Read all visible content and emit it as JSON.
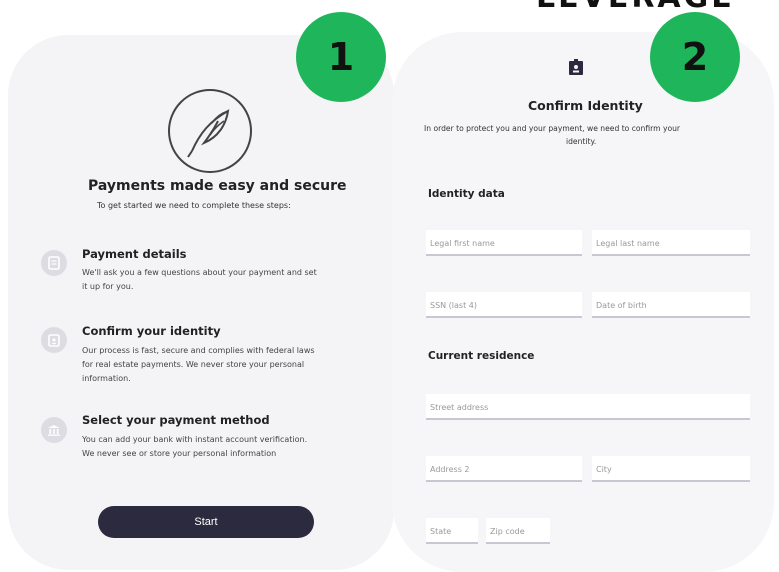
{
  "logo_text": "LEVERAGE",
  "badges": {
    "one": "1",
    "two": "2"
  },
  "intro": {
    "title": "Payments made easy and secure",
    "subtitle": "To get started we need to complete these steps:",
    "steps": [
      {
        "title": "Payment details",
        "line1": "We'll ask you a few questions about your payment and set",
        "line2": "it up for you."
      },
      {
        "title": "Confirm your identity",
        "line1": "Our process is fast, secure and complies with federal laws",
        "line2": "for real estate payments. We never store your personal",
        "line3": "information."
      },
      {
        "title": "Select your payment method",
        "line1": "You can add your bank with instant account verification.",
        "line2": "We never see or store your personal information"
      }
    ],
    "start_label": "Start"
  },
  "identity": {
    "title": "Confirm Identity",
    "desc_line1": "In order to protect you and your payment, we need to confirm your",
    "desc_line2": "identity.",
    "identity_section": "Identity data",
    "residence_section": "Current residence",
    "placeholders": {
      "first_name": "Legal first name",
      "last_name": "Legal last name",
      "ssn": "SSN (last 4)",
      "dob": "Date of birth",
      "street": "Street address",
      "address2": "Address 2",
      "city": "City",
      "state": "State",
      "zip": "Zip code"
    }
  },
  "colors": {
    "badge": "#1fb65b",
    "button": "#2b2a3e",
    "panel": "#f4f4f6"
  }
}
